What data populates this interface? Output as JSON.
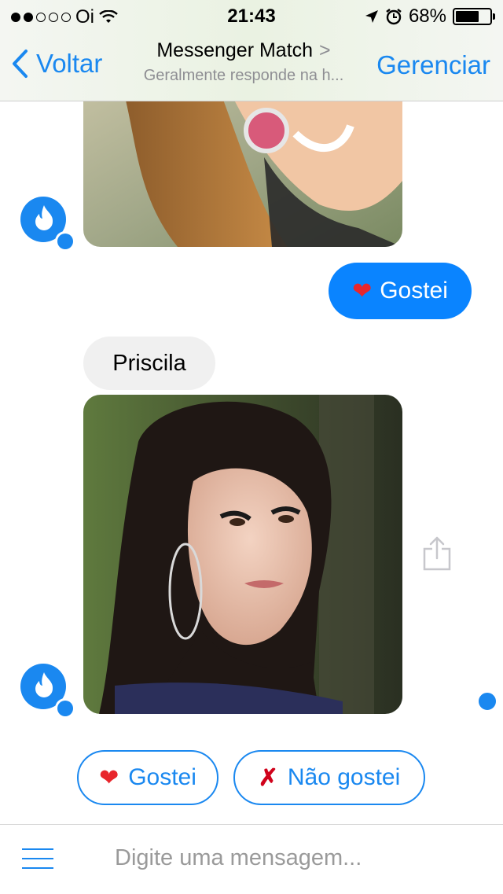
{
  "status": {
    "carrier": "Oi",
    "time": "21:43",
    "battery": "68%",
    "battery_level": 0.68
  },
  "nav": {
    "back_label": "Voltar",
    "title": "Messenger Match",
    "subtitle": "Geralmente responde na h...",
    "manage_label": "Gerenciar"
  },
  "messages": {
    "outgoing_reply": "Gostei",
    "profile_name": "Priscila"
  },
  "quick_replies": {
    "like": "Gostei",
    "dislike": "Não gostei"
  },
  "composer": {
    "placeholder": "Digite uma mensagem..."
  },
  "colors": {
    "accent": "#1a88f0",
    "bubble_out": "#0a84ff",
    "bubble_in": "#f0f0f0"
  },
  "icons": [
    "wifi-icon",
    "location-icon",
    "alarm-icon",
    "chevron-left-icon",
    "chevron-right-icon",
    "flame-icon",
    "messenger-badge-icon",
    "share-icon",
    "heart-icon",
    "x-icon",
    "menu-icon"
  ]
}
